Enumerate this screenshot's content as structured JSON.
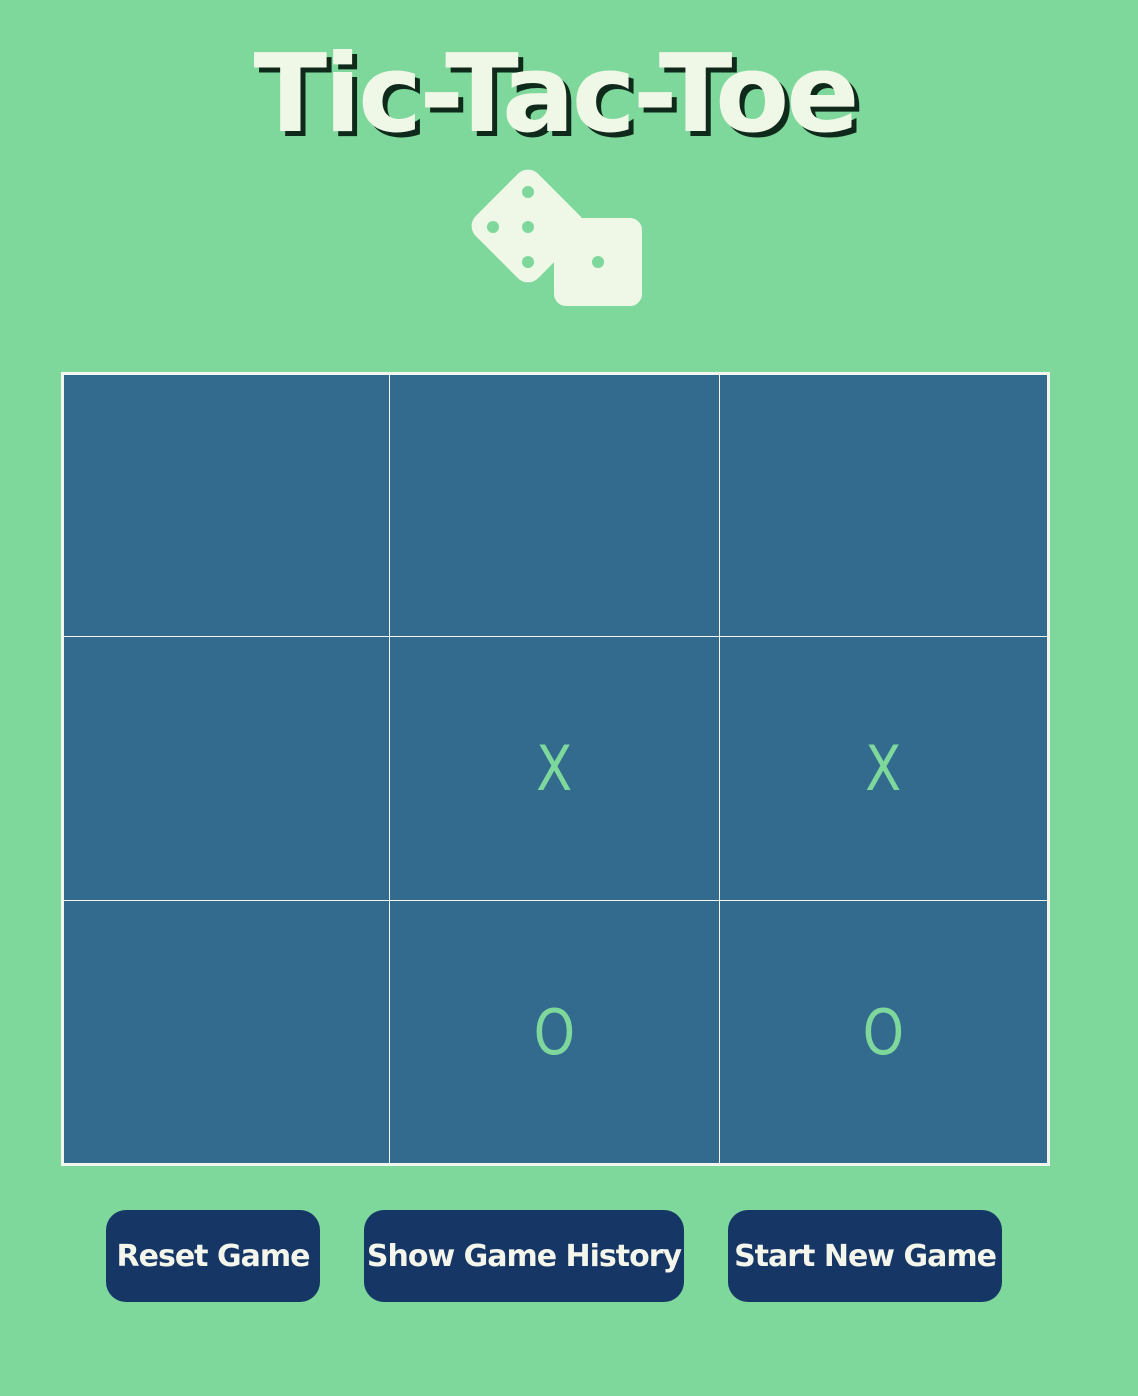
{
  "title": "Tic-Tac-Toe",
  "logo_icon": "dice-icon",
  "board": {
    "cells": [
      "",
      "",
      "",
      "",
      "X",
      "X",
      "",
      "O",
      "O"
    ]
  },
  "buttons": {
    "reset_label": "Reset Game",
    "history_label": "Show Game History",
    "new_game_label": "Start New Game"
  },
  "colors": {
    "background": "#7ed89b",
    "board": "#336b8f",
    "grid_line": "#f2f6ee",
    "mark": "#7ed89b",
    "button": "#163765",
    "title": "#eff7e6"
  }
}
